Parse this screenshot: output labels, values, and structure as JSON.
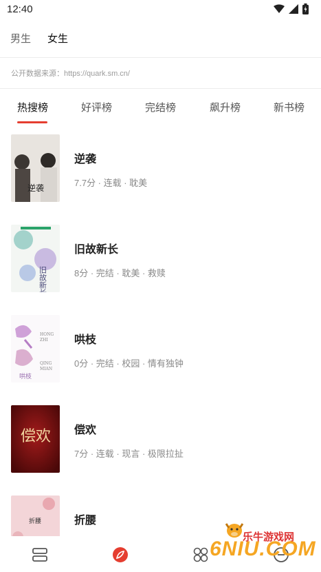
{
  "status_bar": {
    "time": "12:40"
  },
  "gender_tabs": [
    {
      "label": "男生",
      "active": false
    },
    {
      "label": "女生",
      "active": true
    }
  ],
  "source_note": "公开数据来源：https://quark.sm.cn/",
  "rank_tabs": [
    {
      "label": "热搜榜",
      "active": true
    },
    {
      "label": "好评榜",
      "active": false
    },
    {
      "label": "完结榜",
      "active": false
    },
    {
      "label": "飙升榜",
      "active": false
    },
    {
      "label": "新书榜",
      "active": false
    }
  ],
  "books": [
    {
      "title": "逆袭",
      "meta": "7.7分 · 连载 · 耽美",
      "cover_text": "逆袭"
    },
    {
      "title": "旧故新长",
      "meta": "8分 · 完结 · 耽美 · 救赎",
      "cover_text": "旧故新长"
    },
    {
      "title": "哄枝",
      "meta": "0分 · 完结 · 校园 · 情有独钟",
      "cover_text": "哄枝"
    },
    {
      "title": "偿欢",
      "meta": "7分 · 连载 · 现言 · 极限拉扯",
      "cover_text": "偿欢"
    },
    {
      "title": "折腰",
      "meta": "",
      "cover_text": "折腰"
    }
  ],
  "bottom_nav": [
    {
      "icon": "bookshelf-icon"
    },
    {
      "icon": "discover-icon",
      "active": true
    },
    {
      "icon": "category-icon"
    },
    {
      "icon": "profile-icon"
    }
  ],
  "watermark": {
    "text": "乐牛游戏网",
    "brand": "6NIU.COM"
  },
  "colors": {
    "accent": "#e53e30",
    "text": "#222222",
    "muted": "#8a8a8a"
  }
}
